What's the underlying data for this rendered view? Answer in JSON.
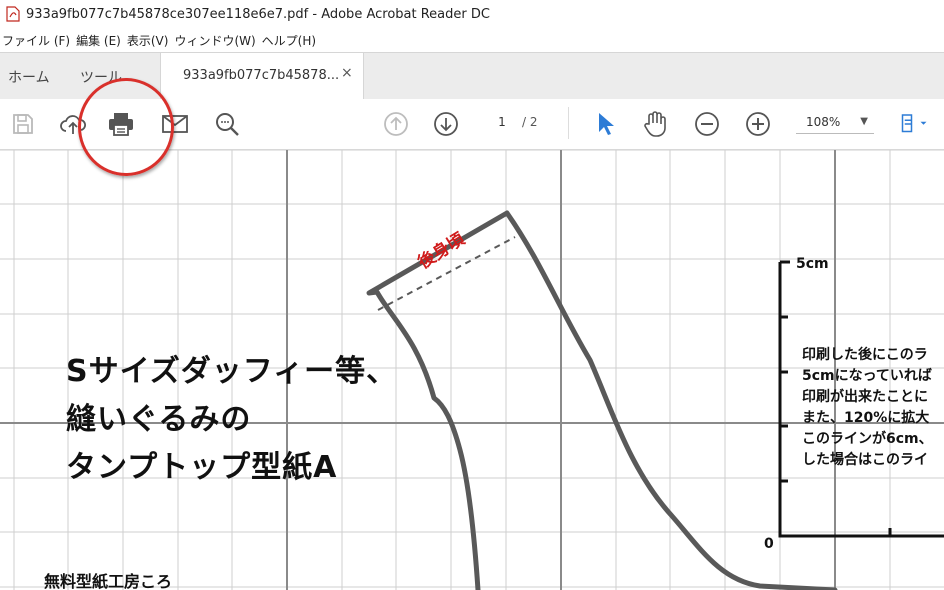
{
  "window": {
    "title": "933a9fb077c7b45878ce307ee118e6e7.pdf - Adobe Acrobat Reader DC"
  },
  "menu": [
    "ファイル (F)",
    "編集 (E)",
    "表示(V)",
    "ウィンドウ(W)",
    "ヘルプ(H)"
  ],
  "tabs": {
    "home": "ホーム",
    "tools": "ツール",
    "document": "933a9fb077c7b45878...",
    "close": "×"
  },
  "toolbar": {
    "icons": [
      "save-icon",
      "upload-cloud-icon",
      "print-icon",
      "email-icon",
      "search-zoom-icon",
      "page-up-icon",
      "page-down-icon",
      "select-cursor-icon",
      "hand-tool-icon",
      "zoom-out-icon",
      "zoom-in-icon",
      "fit-page-icon"
    ],
    "current_page": "1",
    "page_total": "/ 2",
    "zoom": "108%",
    "accent": "#2d7cd6"
  },
  "document": {
    "title_lines": [
      "Sサイズダッフィー等、",
      "縫いぐるみの",
      "タンプトップ型紙A"
    ],
    "pattern_label": "後身頃",
    "footer": "無料型紙工房ころ",
    "ruler_top": "5cm",
    "ruler_bottom": "0",
    "notes": [
      "印刷した後にこのラ",
      "5cmになっていれば",
      "印刷が出来たことに",
      "また、120%に拡大",
      "このラインが6cm、",
      "した場合はこのライ"
    ]
  },
  "annotation": {
    "circle_color": "#d9302b"
  }
}
